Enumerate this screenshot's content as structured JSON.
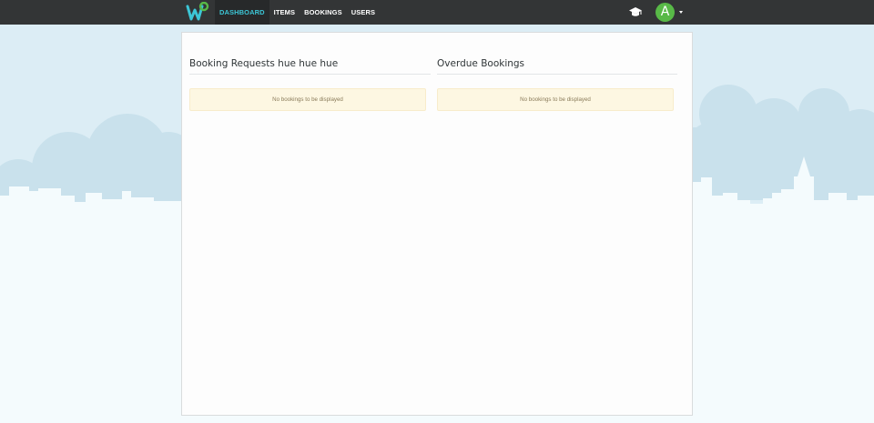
{
  "navbar": {
    "brand_icon": "w-logo",
    "links": [
      {
        "label": "DASHBOARD",
        "active": true
      },
      {
        "label": "ITEMS",
        "active": false
      },
      {
        "label": "BOOKINGS",
        "active": false
      },
      {
        "label": "USERS",
        "active": false
      }
    ],
    "graduation_icon": "graduation-cap-icon",
    "avatar_letter": "A",
    "avatar_color": "#58b947",
    "accent_color": "#3cc6d6"
  },
  "dashboard": {
    "booking_requests": {
      "title": "Booking Requests hue hue hue",
      "empty_message": "No bookings to be displayed"
    },
    "overdue_bookings": {
      "title": "Overdue Bookings",
      "empty_message": "No bookings to be displayed"
    }
  }
}
